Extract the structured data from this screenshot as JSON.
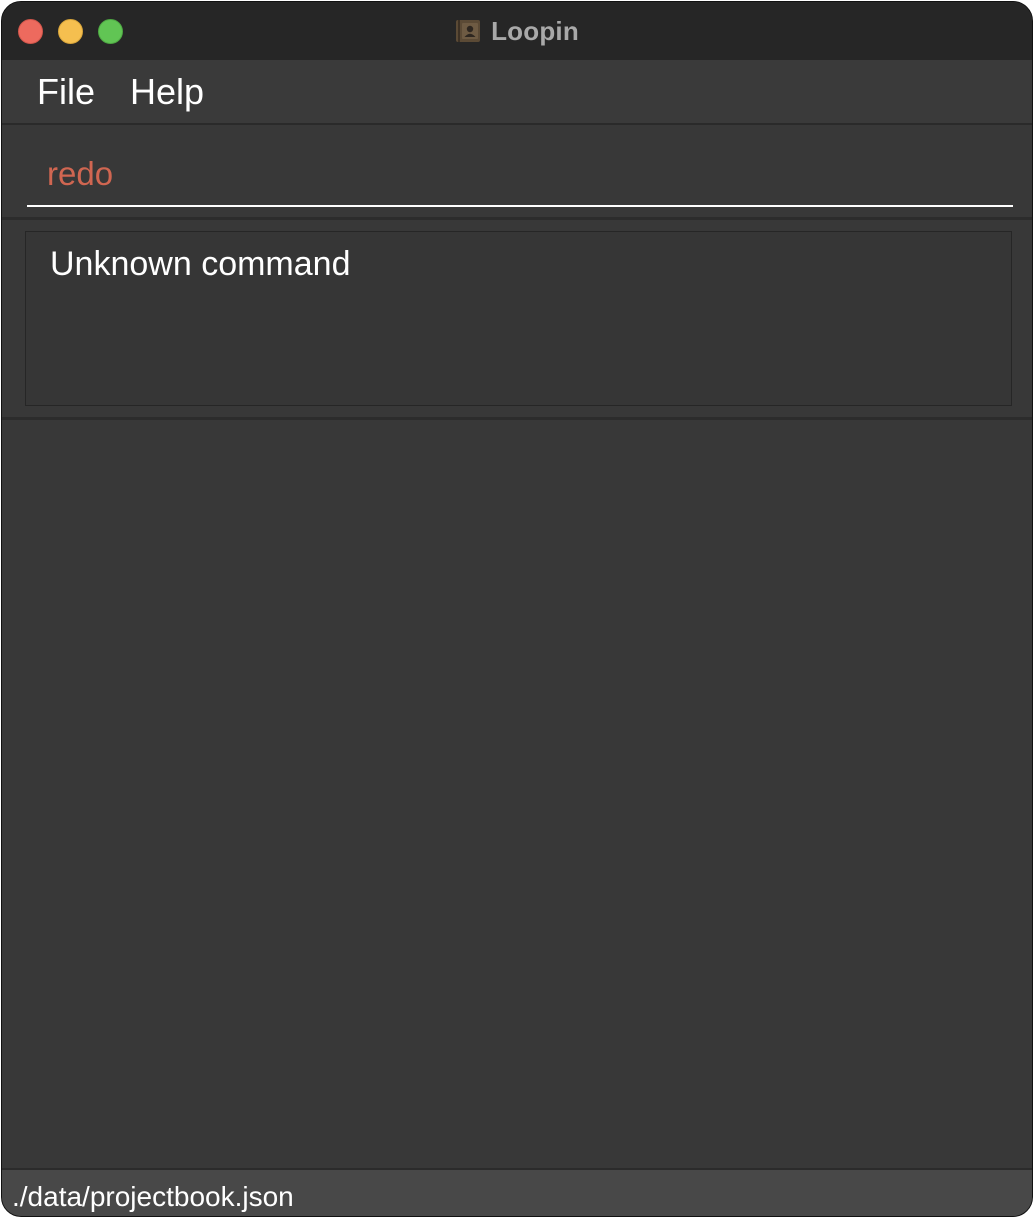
{
  "window": {
    "title": "Loopin",
    "app_icon": "contact-book-icon"
  },
  "menu": {
    "items": [
      {
        "label": "File"
      },
      {
        "label": "Help"
      }
    ]
  },
  "command_box": {
    "value": "redo",
    "text_color": "#d06651"
  },
  "result_display": {
    "message": "Unknown command"
  },
  "status_bar": {
    "file_path": "./data/projectbook.json"
  },
  "colors": {
    "background": "#383838",
    "titlebar": "#262626",
    "close": "#ed6a5e",
    "minimize": "#f5bf4f",
    "maximize": "#61c554"
  }
}
